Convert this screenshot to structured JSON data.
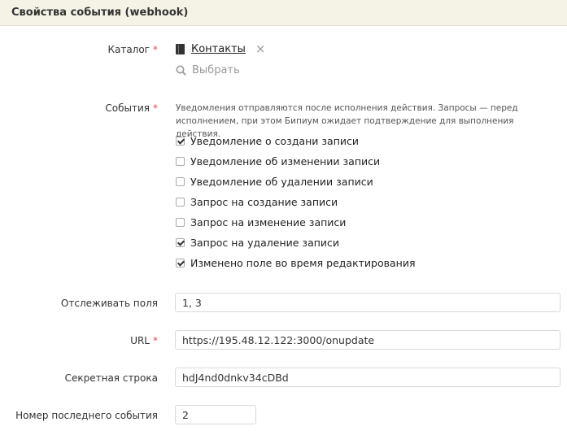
{
  "header": {
    "title": "Свойства события (webhook)"
  },
  "catalog": {
    "label": "Каталог",
    "required_mark": "*",
    "selected": "Контакты",
    "remove_symbol": "×",
    "choose_label": "Выбрать"
  },
  "events": {
    "label": "События",
    "required_mark": "*",
    "hint": "Уведомления отправляются после исполнения действия. Запросы — перед исполнением, при этом Бипиум ожидает подтверждение для выполнения действия.",
    "options": [
      {
        "label": "Уведомление о создани записи",
        "checked": true
      },
      {
        "label": "Уведомление об изменении записи",
        "checked": false
      },
      {
        "label": "Уведомление об удалении записи",
        "checked": false
      },
      {
        "label": "Запрос на создание записи",
        "checked": false
      },
      {
        "label": "Запрос на изменение записи",
        "checked": false
      },
      {
        "label": "Запрос на удаление записи",
        "checked": true
      },
      {
        "label": "Изменено поле во время редактирования",
        "checked": true
      }
    ]
  },
  "fields": {
    "track_fields": {
      "label": "Отслеживать поля",
      "value": "1, 3"
    },
    "url": {
      "label": "URL",
      "required_mark": "*",
      "value": "https://195.48.12.122:3000/onupdate"
    },
    "secret": {
      "label": "Секретная строка",
      "value": "hdJ4nd0dnkv34cDBd"
    },
    "last_event": {
      "label": "Номер последнего события",
      "value": "2"
    }
  }
}
